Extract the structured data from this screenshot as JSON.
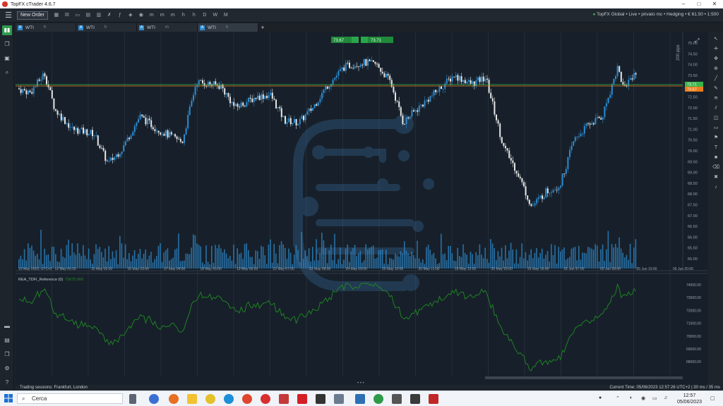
{
  "window": {
    "title": "TopFX cTrader 4.6.7"
  },
  "toolbar": {
    "new_order_label": "New Order",
    "account_info": "TopFX Global • Live • privato mc • Hedging • € 61.50 • 1:500",
    "tools": [
      "m",
      "h",
      "D",
      "W",
      "M"
    ]
  },
  "tabs": [
    {
      "badge": "A",
      "label": "WTI",
      "timeframe": "h"
    },
    {
      "badge": "A",
      "label": "WTI",
      "timeframe": "h"
    },
    {
      "badge": "A",
      "label": "WTI",
      "timeframe": "m"
    },
    {
      "badge": "A",
      "label": "WTI",
      "timeframe": "h"
    }
  ],
  "chart": {
    "symbol": "WTI",
    "quick_trade": {
      "sell_price": "73.67",
      "buy_price": "73.71"
    },
    "current_price_label": "73.67",
    "alt_price_label": "73.71",
    "pips_label": "200 pips",
    "price_ticks": [
      "75.00",
      "74.50",
      "74.00",
      "73.50",
      "73.00",
      "72.50",
      "72.00",
      "71.50",
      "71.00",
      "70.50",
      "70.00",
      "69.50",
      "69.00",
      "68.50",
      "68.00",
      "67.50",
      "67.00",
      "66.50",
      "66.00",
      "65.50",
      "65.00"
    ],
    "date_ticks": [
      "10 May 2023, UTC+2",
      "12 May 05:00",
      "15 May 02:00",
      "16 May 03:00",
      "17 May 04:00",
      "18 May 05:00",
      "19 May 06:00",
      "22 May 07:00",
      "23 May 08:00",
      "24 May 09:00",
      "25 May 10:00",
      "26 May 11:00",
      "29 May 12:00",
      "30 May 15:00",
      "31 May 16:00",
      "01 Jun 17:00",
      "02 Jun 18:00",
      "05 Jun 19:00",
      "06 Jun 20:00"
    ],
    "indicator_label": "REA_TDFI_Reference (0)",
    "indicator_value": "73675.000",
    "indicator_ticks": [
      "74000.00",
      "73000.00",
      "72000.00",
      "71000.00",
      "70000.00",
      "69000.00",
      "68000.00"
    ],
    "colors": {
      "bull": "#2d8cd1",
      "bear": "#e6e6e6",
      "indicator": "#1f8a22",
      "price_line": "#e87d1e",
      "ask_line": "#3cb44b"
    }
  },
  "statusbar": {
    "sessions": "Trading sessions: Frankfurt, London",
    "current_time": "Current Time:  05/06/2023 12:57:26   UTC+2   |  30 ms / 35 ms"
  },
  "taskbar": {
    "search_placeholder": "Cerca",
    "time": "12:57",
    "date": "05/06/2023"
  }
}
